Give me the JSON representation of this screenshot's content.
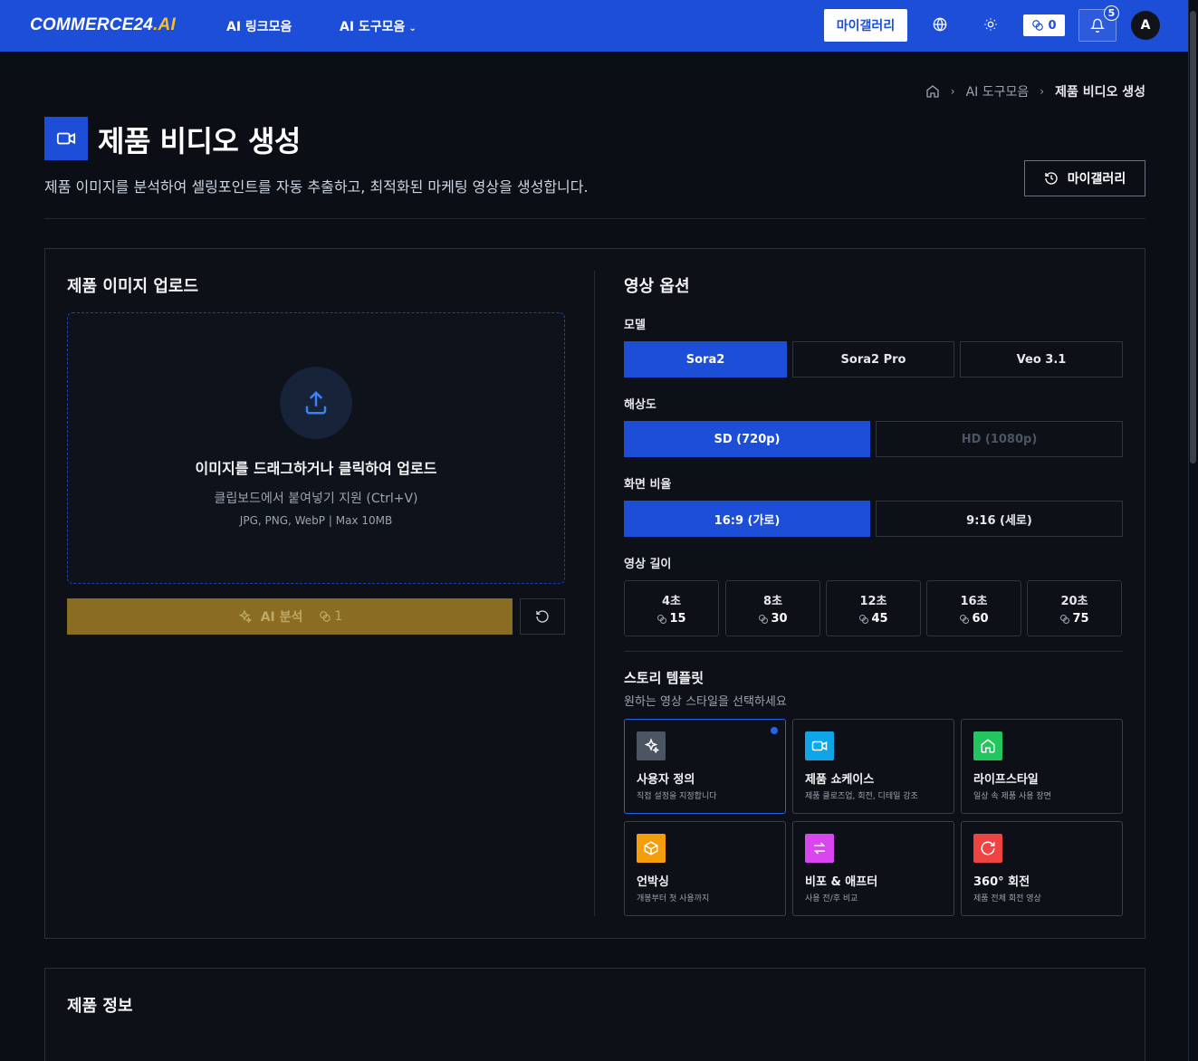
{
  "nav": {
    "logo_main": "COMMERCE24",
    "logo_suffix": ".AI",
    "link_collection": "AI 링크모음",
    "tool_collection": "AI 도구모음",
    "tool_caret": "⌄",
    "gallery": "마이갤러리",
    "credits": "0",
    "notifications": "5",
    "avatar": "A"
  },
  "breadcrumb": {
    "parent": "AI 도구모음",
    "current": "제품 비디오 생성"
  },
  "header": {
    "title": "제품 비디오 생성",
    "description": "제품 이미지를 분석하여 셀링포인트를 자동 추출하고, 최적화된 마케팅 영상을 생성합니다.",
    "gallery_button": "마이갤러리"
  },
  "upload": {
    "title": "제품 이미지 업로드",
    "drop_title": "이미지를 드래그하거나 클릭하여 업로드",
    "drop_sub": "클립보드에서 붙여넣기 지원 (Ctrl+V)",
    "drop_note": "JPG, PNG, WebP | Max 10MB",
    "ai_button": "AI 분석",
    "ai_cost": "1"
  },
  "options": {
    "title": "영상 옵션",
    "model_label": "모델",
    "models": [
      "Sora2",
      "Sora2 Pro",
      "Veo 3.1"
    ],
    "resolution_label": "해상도",
    "resolutions": [
      "SD (720p)",
      "HD (1080p)"
    ],
    "ratio_label": "화면 비율",
    "ratios": [
      "16:9 (가로)",
      "9:16 (세로)"
    ],
    "duration_label": "영상 길이",
    "durations": [
      {
        "sec": "4초",
        "cost": "15"
      },
      {
        "sec": "8초",
        "cost": "30"
      },
      {
        "sec": "12초",
        "cost": "45"
      },
      {
        "sec": "16초",
        "cost": "60"
      },
      {
        "sec": "20초",
        "cost": "75"
      }
    ],
    "story_title": "스토리 템플릿",
    "story_desc": "원하는 영상 스타일을 선택하세요",
    "templates": [
      {
        "name": "사용자 정의",
        "desc": "직접 설정을 지정합니다",
        "color": "#4b5563",
        "icon": "sparkles-icon"
      },
      {
        "name": "제품 쇼케이스",
        "desc": "제품 클로즈업, 회전, 디테일 강조",
        "color": "#0ea5e9",
        "icon": "video-icon"
      },
      {
        "name": "라이프스타일",
        "desc": "일상 속 제품 사용 장면",
        "color": "#22c55e",
        "icon": "home-icon"
      },
      {
        "name": "언박싱",
        "desc": "개봉부터 첫 사용까지",
        "color": "#f59e0b",
        "icon": "box-icon"
      },
      {
        "name": "비포 & 애프터",
        "desc": "사용 전/후 비교",
        "color": "#d946ef",
        "icon": "swap-icon"
      },
      {
        "name": "360° 회전",
        "desc": "제품 전체 회전 영상",
        "color": "#ef4444",
        "icon": "rotate-icon"
      }
    ]
  },
  "product_info": {
    "title": "제품 정보"
  }
}
